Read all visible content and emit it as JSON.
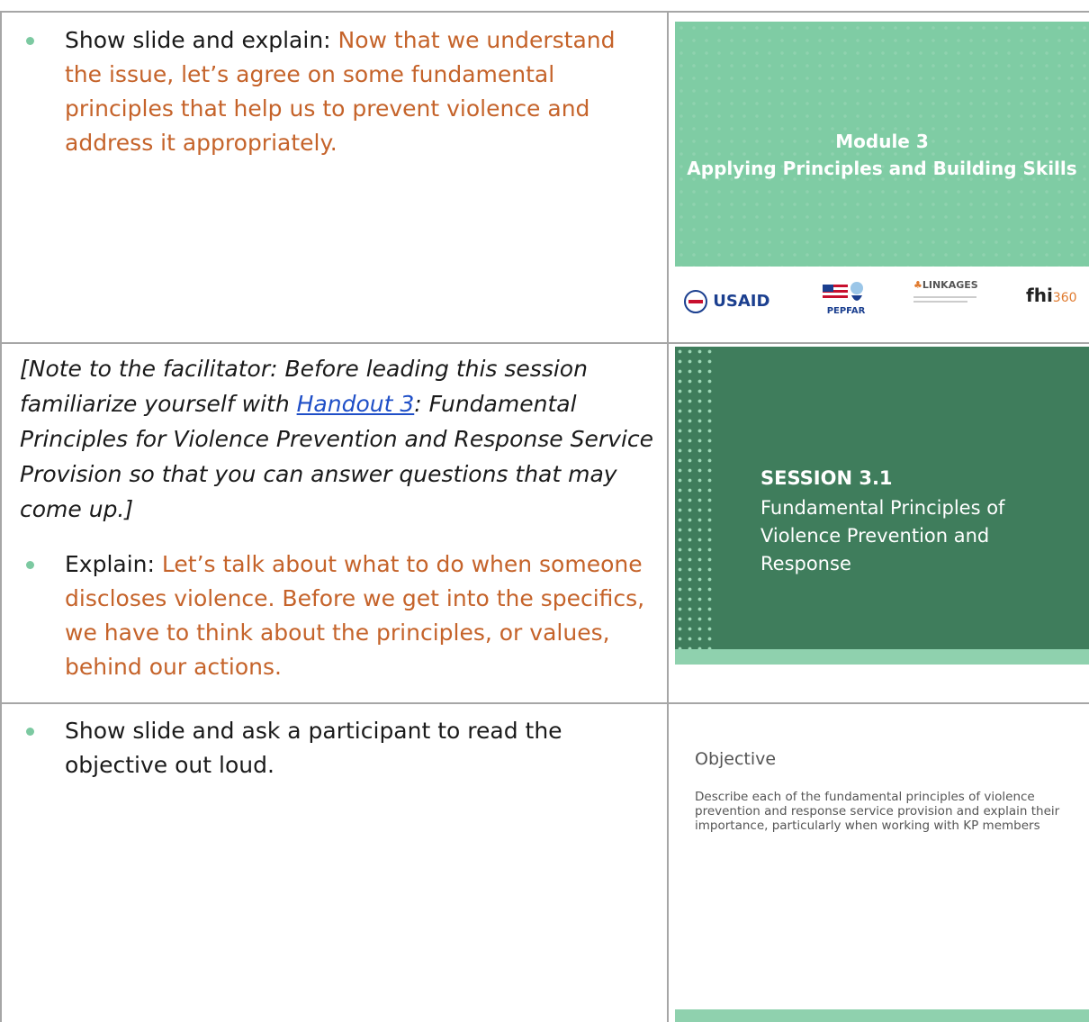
{
  "row1": {
    "bullet_lead": "Show slide and explain: ",
    "bullet_text": "Now that we understand the issue, let’s agree on some fundamental principles that help us to prevent violence and address it appropriately."
  },
  "slide1": {
    "title_line1": "Module 3",
    "title_line2": "Applying Principles and Building Skills",
    "logos": {
      "usaid": "USAID",
      "pepfar": "PEPFAR",
      "linkages": "LINKAGES",
      "fhi": "fhi",
      "fhi_num": "360"
    }
  },
  "row2": {
    "note_part1": "[Note to the facilitator: Before leading this session familiarize yourself with ",
    "note_link": "Handout 3",
    "note_part2": ": Fundamental Principles for Violence Prevention and Response Service Provision so that you can answer questions that may come up.]",
    "bullet_lead": "Explain: ",
    "bullet_text": "Let’s talk about what to do when someone discloses violence. Before we get into the specifics, we have to think about the principles, or values, behind our actions."
  },
  "slide2": {
    "heading": "SESSION 3.1",
    "subtitle": "Fundamental Principles of Violence Prevention and Response"
  },
  "row3": {
    "bullet_text": "Show slide and ask a participant to read the objective out loud."
  },
  "slide3": {
    "title": "Objective",
    "body": "Describe each of the fundamental principles of violence prevention and response service provision and explain their importance, particularly when working with KP members"
  },
  "colors": {
    "accent_orange": "#c5632a",
    "bullet_green": "#7cc9a1",
    "slide_green_light": "#7fcca4",
    "slide_green_dark": "#3f7d5c"
  }
}
